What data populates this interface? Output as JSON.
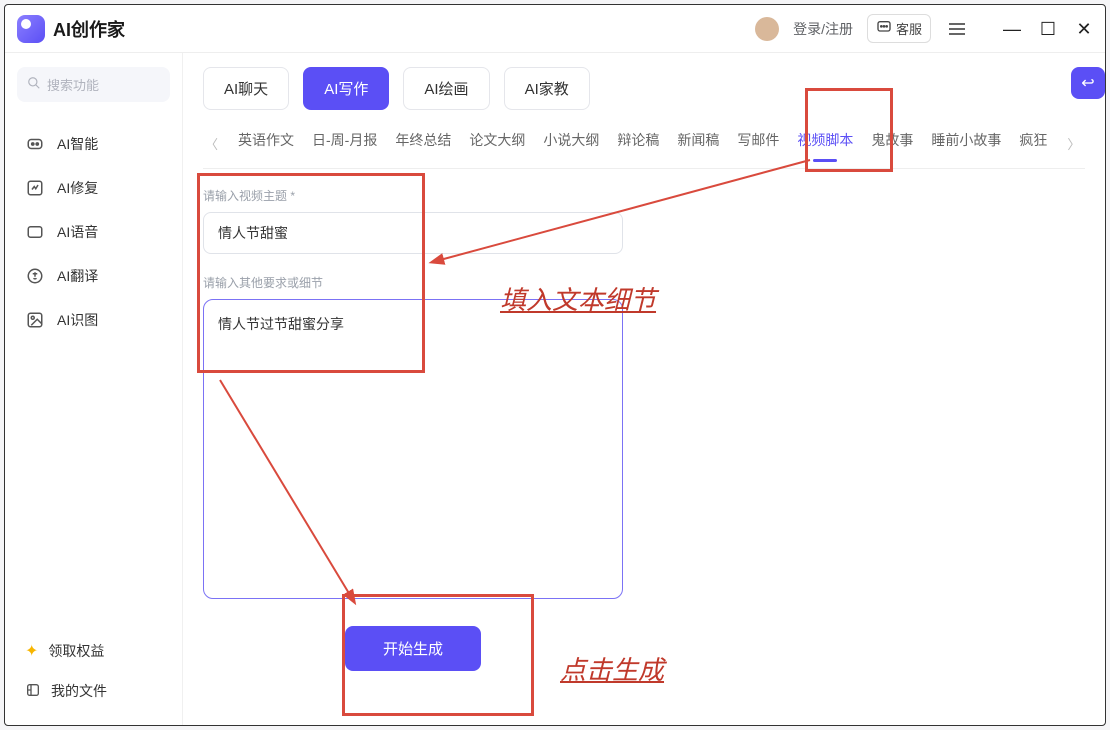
{
  "app": {
    "title": "AI创作家",
    "login": "登录/注册",
    "support": "客服"
  },
  "sidebar": {
    "search_placeholder": "搜索功能",
    "items": [
      {
        "label": "AI智能"
      },
      {
        "label": "AI修复"
      },
      {
        "label": "AI语音"
      },
      {
        "label": "AI翻译"
      },
      {
        "label": "AI识图"
      }
    ],
    "footer": {
      "vip": "领取权益",
      "files": "我的文件"
    }
  },
  "modes": {
    "chat": "AI聊天",
    "write": "AI写作",
    "draw": "AI绘画",
    "tutor": "AI家教"
  },
  "subcats": {
    "items": [
      "英语作文",
      "日-周-月报",
      "年终总结",
      "论文大纲",
      "小说大纲",
      "辩论稿",
      "新闻稿",
      "写邮件",
      "视频脚本",
      "鬼故事",
      "睡前小故事",
      "疯狂"
    ],
    "active_index": 8
  },
  "form": {
    "label_topic": "请输入视频主题 *",
    "value_topic": "情人节甜蜜",
    "label_detail": "请输入其他要求或细节",
    "value_detail": "情人节过节甜蜜分享",
    "submit": "开始生成"
  },
  "annotations": {
    "fill_text": "填入文本细节",
    "click_gen": "点击生成"
  }
}
